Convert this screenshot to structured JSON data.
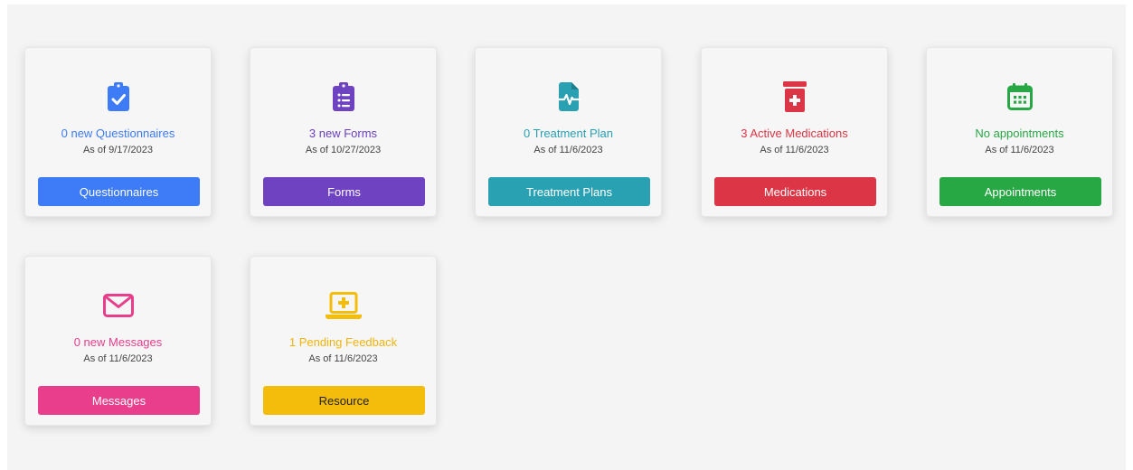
{
  "cards": [
    {
      "title": "0 new Questionnaires",
      "date": "As of 9/17/2023",
      "button": "Questionnaires",
      "icon": "clipboard-check-icon",
      "color": "#3d7bf7"
    },
    {
      "title": "3 new Forms",
      "date": "As of 10/27/2023",
      "button": "Forms",
      "icon": "clipboard-list-icon",
      "color": "#6f42c1"
    },
    {
      "title": "0 Treatment Plan",
      "date": "As of 11/6/2023",
      "button": "Treatment Plans",
      "icon": "medical-file-icon",
      "color": "#2aa1b3"
    },
    {
      "title": "3 Active Medications",
      "date": "As of 11/6/2023",
      "button": "Medications",
      "icon": "pill-bottle-icon",
      "color": "#dc3545"
    },
    {
      "title": "No appointments",
      "date": "As of 11/6/2023",
      "button": "Appointments",
      "icon": "calendar-icon",
      "color": "#28a745"
    },
    {
      "title": "0 new Messages",
      "date": "As of 11/6/2023",
      "button": "Messages",
      "icon": "envelope-icon",
      "color": "#e83e8c"
    },
    {
      "title": "1 Pending Feedback",
      "date": "As of 11/6/2023",
      "button": "Resource",
      "icon": "laptop-medical-icon",
      "color": "#f4bd0b"
    }
  ]
}
